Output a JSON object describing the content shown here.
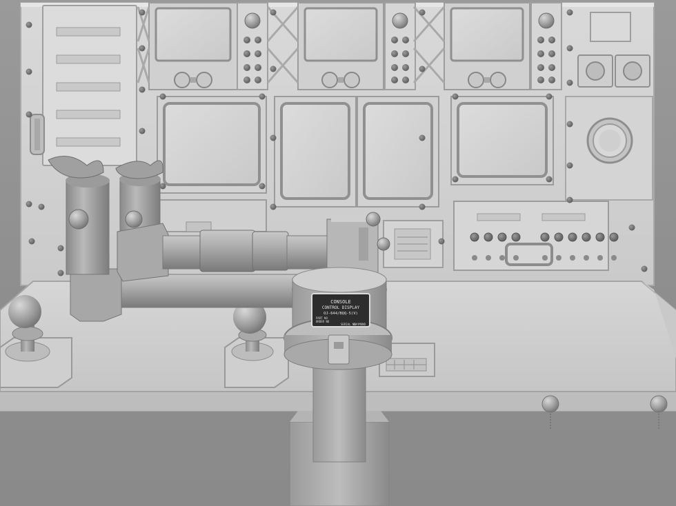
{
  "scene": {
    "subject": "console-control-display-3d-render",
    "colors": {
      "background": "#929292",
      "panel": "#d2d2d2",
      "panel_dark": "#b9b9b9",
      "panel_light": "#e4e4e4",
      "bolt": "#6f6f6f",
      "plate": "#2a2a2a",
      "plate_text": "#e8e8e8"
    }
  },
  "nameplate": {
    "line1": "CONSOLE",
    "line2": "CONTROL DISPLAY",
    "line3": "OJ-644/BQQ-5(V)",
    "row_labels": [
      "PART NO",
      "ORDER NO",
      "SERIAL NO"
    ],
    "footer": "RAYMOND"
  },
  "controls": {
    "joysticks": 2,
    "upper_displays": 3,
    "lower_displays": 4,
    "knob_row_count": 10
  }
}
